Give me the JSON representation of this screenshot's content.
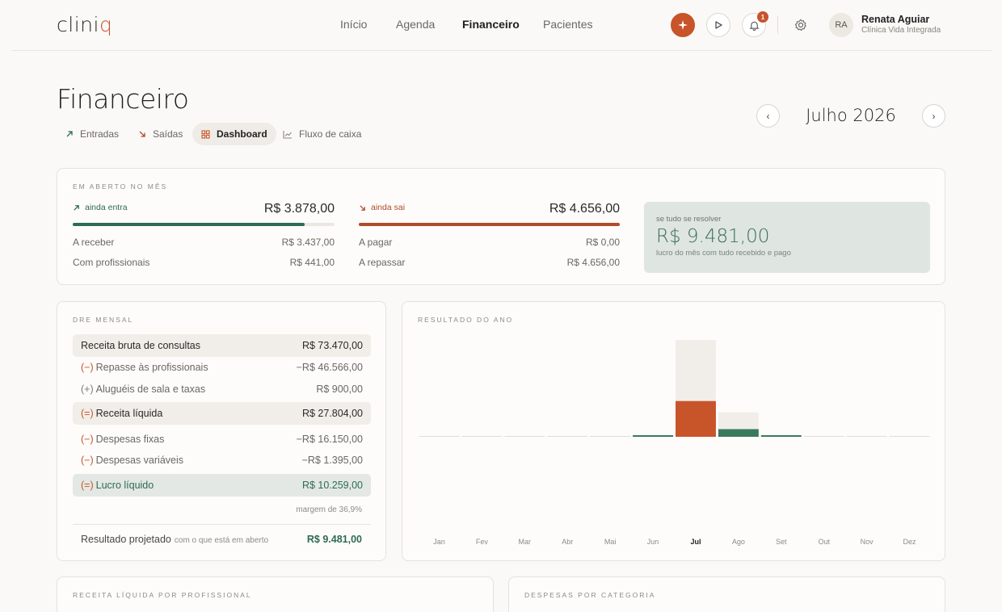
{
  "app": {
    "logo_main": "clini",
    "logo_accent": "q"
  },
  "nav": {
    "items": [
      "Início",
      "Agenda",
      "Financeiro",
      "Pacientes"
    ],
    "active": "Financeiro"
  },
  "notifications": {
    "count": "1"
  },
  "user": {
    "initials": "RA",
    "name": "Renata Aguiar",
    "org": "Clínica Vida Integrada"
  },
  "page": {
    "title": "Financeiro"
  },
  "tabs": [
    {
      "label": "Entradas",
      "icon": "arrow-up-right-icon"
    },
    {
      "label": "Saídas",
      "icon": "arrow-down-right-icon"
    },
    {
      "label": "Dashboard",
      "icon": "grid-icon",
      "active": true
    },
    {
      "label": "Fluxo de caixa",
      "icon": "line-chart-icon"
    }
  ],
  "month": {
    "label": "Julho 2026",
    "prev": "‹",
    "next": "›"
  },
  "summary": {
    "section_label": "Em aberto no mês",
    "incoming": {
      "label": "ainda entra",
      "total": "R$ 3.878,00",
      "progress": 0.885,
      "rows": [
        {
          "label": "A receber",
          "value": "R$ 3.437,00"
        },
        {
          "label": "Com profissionais",
          "value": "R$ 441,00"
        }
      ]
    },
    "outgoing": {
      "label": "ainda sai",
      "total": "R$ 4.656,00",
      "progress": 1.0,
      "rows": [
        {
          "label": "A pagar",
          "value": "R$ 0,00"
        },
        {
          "label": "A repassar",
          "value": "R$ 4.656,00"
        }
      ]
    },
    "projection": {
      "caption": "se tudo se resolver",
      "value": "R$ 9.481,00",
      "subtitle": "lucro do mês com tudo recebido e pago"
    }
  },
  "dre": {
    "section_label": "DRE mensal",
    "rows": [
      {
        "sign": "",
        "label": "Receita bruta de consultas",
        "value": "R$ 73.470,00"
      },
      {
        "sign": "(−)",
        "label": "Repasse às profissionais",
        "value": "−R$ 46.566,00"
      },
      {
        "sign": "(+)",
        "label": "Aluguéis de sala e taxas",
        "value": "R$ 900,00"
      },
      {
        "sign": "(=)",
        "label": "Receita líquida",
        "value": "R$ 27.804,00"
      },
      {
        "sign": "(−)",
        "label": "Despesas fixas",
        "value": "−R$ 16.150,00"
      },
      {
        "sign": "(−)",
        "label": "Despesas variáveis",
        "value": "−R$ 1.395,00"
      },
      {
        "sign": "(=)",
        "label": "Lucro líquido",
        "value": "R$ 10.259,00"
      }
    ],
    "margin_note": "margem de 36,9%",
    "projected": {
      "label": "Resultado projetado",
      "hint": "com o que está em aberto",
      "value": "R$ 9.481,00"
    }
  },
  "year_chart": {
    "section_label": "Resultado do ano",
    "active_month": "Jul"
  },
  "chart_data": {
    "type": "bar",
    "categories": [
      "Jan",
      "Fev",
      "Mar",
      "Abr",
      "Mai",
      "Jun",
      "Jul",
      "Ago",
      "Set",
      "Out",
      "Nov",
      "Dez"
    ],
    "series": [
      {
        "values": [
          0,
          0,
          0,
          0,
          0,
          300,
          10259,
          2200,
          200,
          0,
          0,
          0
        ]
      },
      {
        "values": [
          0,
          0,
          0,
          0,
          0,
          0,
          27804,
          7000,
          0,
          0,
          0,
          0
        ]
      }
    ],
    "colors": {
      "profit": "#c8542a",
      "profit_future": "#3a7a5c",
      "background_bar": "#f1eee9",
      "baseline": "#e1ddd7"
    }
  },
  "bottom": {
    "left_label": "Receita líquida por profissional",
    "right_label": "Despesas por categoria"
  },
  "colors": {
    "accent": "#c8542a",
    "green": "#2e6b52",
    "background": "#faf9f7"
  }
}
